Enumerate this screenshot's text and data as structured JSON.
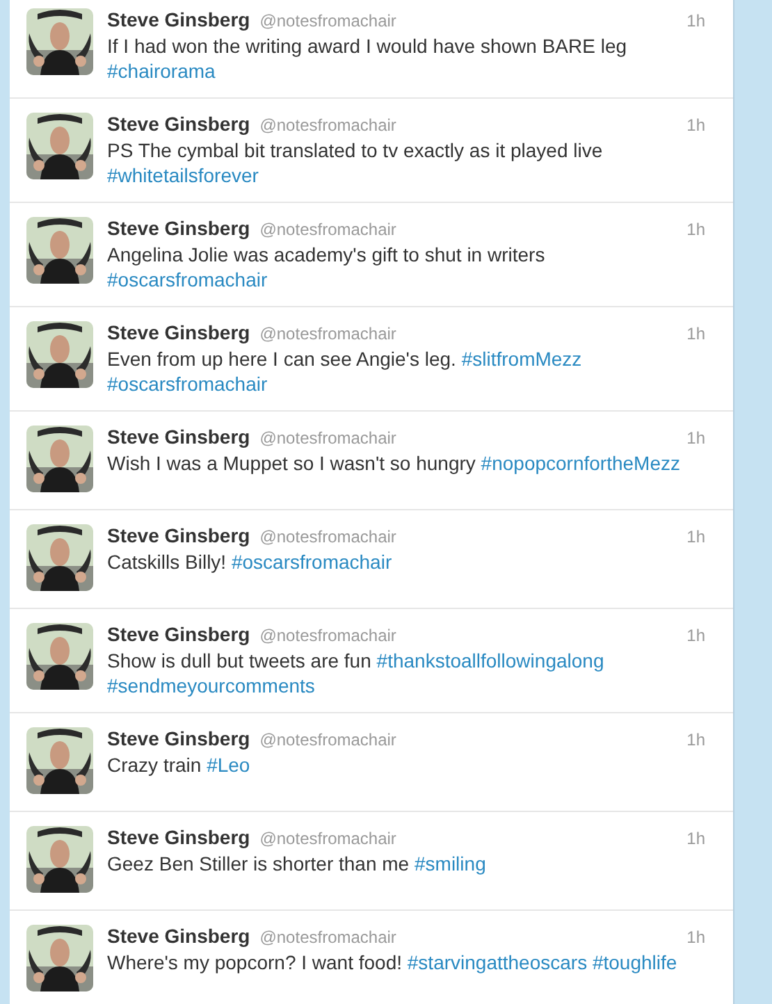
{
  "tweets": [
    {
      "name": "Steve Ginsberg",
      "handle": "@notesfromachair",
      "time": "1h",
      "parts": [
        {
          "kind": "plain",
          "text": "If I had won the writing award I would have shown BARE leg"
        },
        {
          "kind": "hashtag",
          "text": "#chairorama"
        }
      ]
    },
    {
      "name": "Steve Ginsberg",
      "handle": "@notesfromachair",
      "time": "1h",
      "parts": [
        {
          "kind": "plain",
          "text": "PS The cymbal bit translated to tv exactly as it played live"
        },
        {
          "kind": "hashtag",
          "text": "#whitetailsforever"
        }
      ]
    },
    {
      "name": "Steve Ginsberg",
      "handle": "@notesfromachair",
      "time": "1h",
      "parts": [
        {
          "kind": "plain",
          "text": "Angelina Jolie was academy's gift to shut in writers"
        },
        {
          "kind": "hashtag",
          "text": "#oscarsfromachair"
        }
      ]
    },
    {
      "name": "Steve Ginsberg",
      "handle": "@notesfromachair",
      "time": "1h",
      "parts": [
        {
          "kind": "plain",
          "text": "Even from up here I can see Angie's leg."
        },
        {
          "kind": "hashtag",
          "text": "#slitfromMezz"
        },
        {
          "kind": "hashtag",
          "text": "#oscarsfromachair"
        }
      ]
    },
    {
      "name": "Steve Ginsberg",
      "handle": "@notesfromachair",
      "time": "1h",
      "parts": [
        {
          "kind": "plain",
          "text": "Wish I was a Muppet so I wasn't so hungry"
        },
        {
          "kind": "hashtag",
          "text": "#nopopcornfortheMezz"
        }
      ]
    },
    {
      "name": "Steve Ginsberg",
      "handle": "@notesfromachair",
      "time": "1h",
      "parts": [
        {
          "kind": "plain",
          "text": "Catskills Billy!"
        },
        {
          "kind": "hashtag",
          "text": "#oscarsfromachair"
        }
      ]
    },
    {
      "name": "Steve Ginsberg",
      "handle": "@notesfromachair",
      "time": "1h",
      "parts": [
        {
          "kind": "plain",
          "text": "Show is dull but tweets are fun"
        },
        {
          "kind": "hashtag",
          "text": "#thankstoallfollowingalong"
        },
        {
          "kind": "hashtag",
          "text": "#sendmeyourcomments"
        }
      ]
    },
    {
      "name": "Steve Ginsberg",
      "handle": "@notesfromachair",
      "time": "1h",
      "parts": [
        {
          "kind": "plain",
          "text": "Crazy train"
        },
        {
          "kind": "hashtag",
          "text": "#Leo"
        }
      ]
    },
    {
      "name": "Steve Ginsberg",
      "handle": "@notesfromachair",
      "time": "1h",
      "parts": [
        {
          "kind": "plain",
          "text": "Geez Ben Stiller is shorter than me"
        },
        {
          "kind": "hashtag",
          "text": "#smiling"
        }
      ]
    },
    {
      "name": "Steve Ginsberg",
      "handle": "@notesfromachair",
      "time": "1h",
      "parts": [
        {
          "kind": "plain",
          "text": "Where's my popcorn? I want food!"
        },
        {
          "kind": "hashtag",
          "text": "#starvingattheoscars"
        },
        {
          "kind": "hashtag",
          "text": "#toughlife"
        }
      ]
    }
  ]
}
